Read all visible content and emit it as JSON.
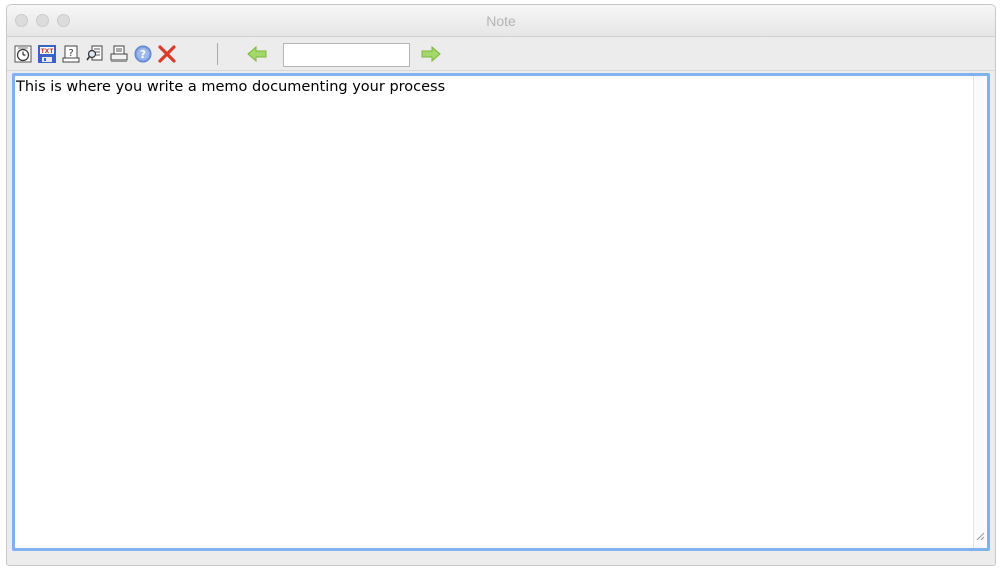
{
  "window": {
    "title": "Note"
  },
  "toolbar": {
    "icons": [
      {
        "name": "clock-icon"
      },
      {
        "name": "save-txt-icon",
        "label": "TXT"
      },
      {
        "name": "help-document-icon"
      },
      {
        "name": "search-document-icon"
      },
      {
        "name": "print-icon"
      },
      {
        "name": "help-icon"
      },
      {
        "name": "close-icon"
      }
    ],
    "nav_input_value": ""
  },
  "editor": {
    "text": "This is where you write a memo documenting your process"
  },
  "colors": {
    "focus_border": "#7fb1ef",
    "arrow_green": "#8cc63f",
    "close_red": "#d93b2b",
    "save_blue": "#3a63c7"
  }
}
